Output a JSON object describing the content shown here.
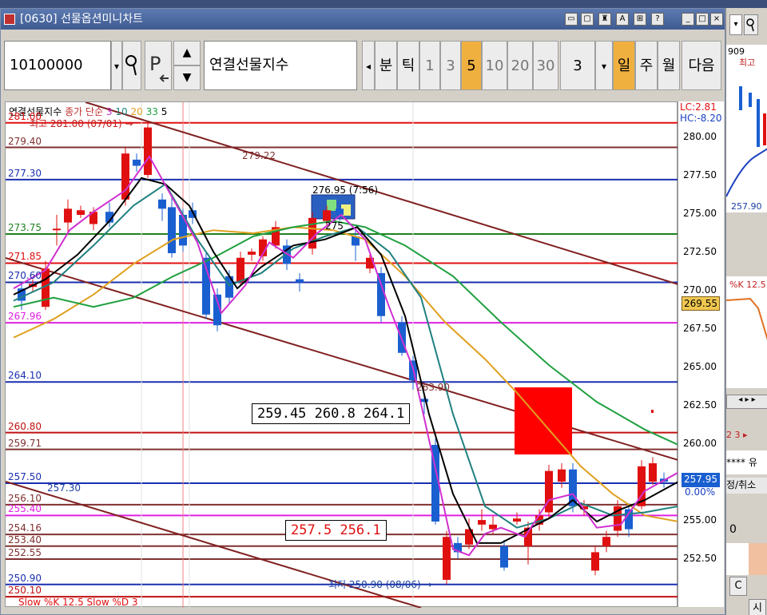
{
  "window": {
    "title": "[0630] 선물옵션미니차트",
    "title_buttons": [
      "▭",
      "▢",
      "♜",
      "A",
      "⊞",
      "?",
      "_",
      "□",
      "×"
    ]
  },
  "toolbar": {
    "code_value": "10100000",
    "instrument": "연결선물지수",
    "left_arrow": "◂",
    "period_buttons": [
      "분",
      "틱",
      "1",
      "3",
      "5",
      "10",
      "20",
      "30"
    ],
    "selected_period": "5",
    "interval_value": "3",
    "dd_arrow": "▾",
    "range_buttons": [
      "일",
      "주",
      "월"
    ],
    "next_label": "다음"
  },
  "chart": {
    "legend": {
      "name": "연결선물지수",
      "ma_label": "종가 단순",
      "ma_periods": [
        "3",
        "10",
        "20",
        "33",
        "5"
      ]
    },
    "high_note": "최고 281.00 (07/01) →",
    "low_note": "최저 250.90 (08/06) →",
    "note_279": "279.22",
    "note_276": "276.95 (7:56)",
    "note_275": "275",
    "note_263": "263.90",
    "note_257": "257.30",
    "box1": "259.45  260.8  264.1",
    "box2": "257.5   256.1",
    "lc_label": "LC:2.81",
    "hc_label": "HC:-8.20",
    "bottom_label": "Slow %K 12.5   Slow %D 3",
    "h_levels": [
      "281.00",
      "279.40",
      "277.30",
      "273.75",
      "271.85",
      "270.60",
      "267.96",
      "264.10",
      "260.80",
      "259.71",
      "257.50",
      "256.10",
      "255.40",
      "254.16",
      "253.40",
      "252.55",
      "250.90",
      "250.10"
    ],
    "y_ticks": [
      "280.00",
      "277.50",
      "275.00",
      "272.50",
      "270.00",
      "267.50",
      "265.00",
      "262.50",
      "260.00",
      "257.50",
      "255.00",
      "252.50"
    ],
    "current_price": "269.55",
    "last_price": "257.95",
    "last_change": "0.00%"
  },
  "right_pane": {
    "top_value": "909",
    "top_label": "최고",
    "value_257": "257.90",
    "k_label": "%K 12.5",
    "asterisks": "****",
    "yu_label": "유",
    "order_label": "정/취소",
    "zero": "0",
    "c_label": "C",
    "si_label": "시"
  },
  "colors": {
    "up": "#e01010",
    "down": "#1a5fd0",
    "title_bg": "#3e5a92",
    "selected": "#f0b040"
  }
}
